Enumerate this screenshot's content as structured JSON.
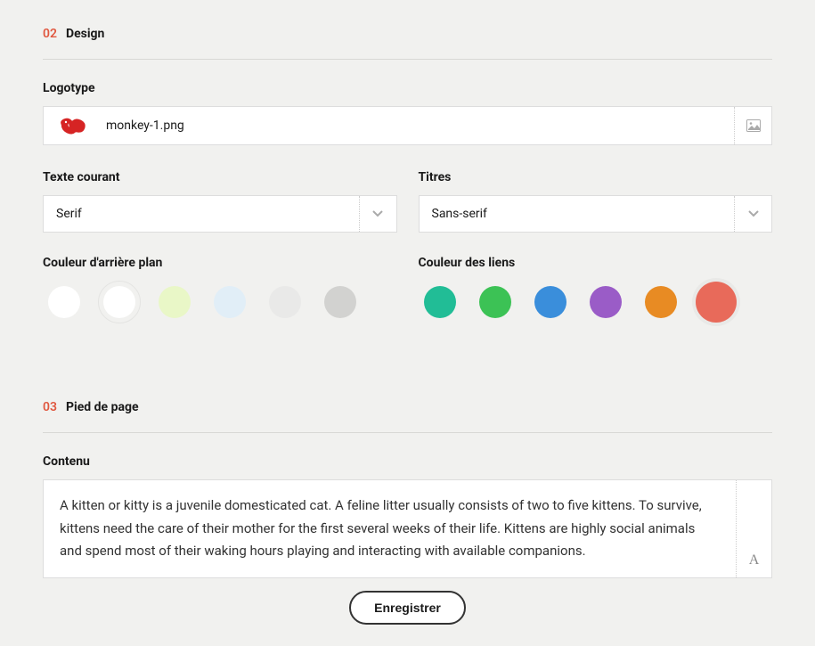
{
  "sections": {
    "design": {
      "number": "02",
      "title": "Design"
    },
    "footer": {
      "number": "03",
      "title": "Pied de page"
    }
  },
  "logotype": {
    "label": "Logotype",
    "filename": "monkey-1.png"
  },
  "body_font": {
    "label": "Texte courant",
    "value": "Serif"
  },
  "heading_font": {
    "label": "Titres",
    "value": "Sans-serif"
  },
  "bg_color": {
    "label": "Couleur d'arrière plan",
    "options": [
      {
        "color": "#ffffff",
        "selected": false,
        "highlighted": false
      },
      {
        "color": "#ffffff",
        "selected": false,
        "highlighted": true
      },
      {
        "color": "#e9f7c7",
        "selected": false,
        "highlighted": false
      },
      {
        "color": "#e1eef7",
        "selected": false,
        "highlighted": false
      },
      {
        "color": "#e9e9e8",
        "selected": false,
        "highlighted": false
      },
      {
        "color": "#d2d2d0",
        "selected": false,
        "highlighted": false
      }
    ]
  },
  "link_color": {
    "label": "Couleur des liens",
    "options": [
      {
        "color": "#21bd96",
        "selected": false
      },
      {
        "color": "#3cc255",
        "selected": false
      },
      {
        "color": "#3a8edb",
        "selected": false
      },
      {
        "color": "#9a5cc7",
        "selected": false
      },
      {
        "color": "#e88b23",
        "selected": false
      },
      {
        "color": "#e86a5a",
        "selected": true
      }
    ]
  },
  "content": {
    "label": "Contenu",
    "text": "A kitten or kitty is a juvenile domesticated cat. A feline litter usually consists of two to five kittens. To survive, kittens need the care of their mother for the first several weeks of their life. Kittens are highly social animals and spend most of their waking hours playing and interacting with available companions.",
    "format_glyph": "A"
  },
  "actions": {
    "save": "Enregistrer"
  }
}
